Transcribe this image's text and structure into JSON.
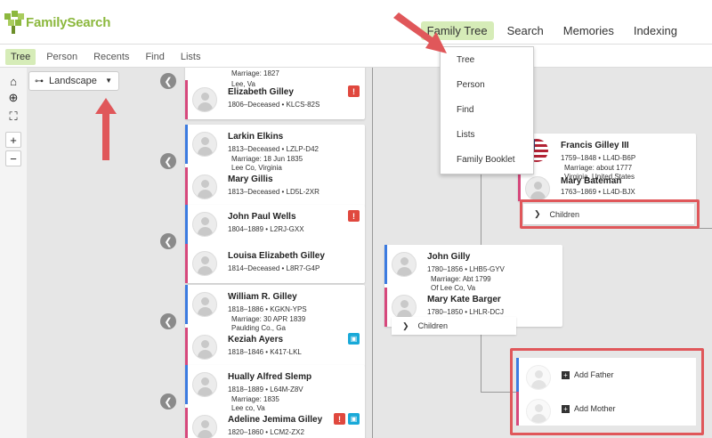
{
  "brand": {
    "name": "FamilySearch"
  },
  "main_nav": [
    {
      "label": "Family Tree",
      "active": true
    },
    {
      "label": "Search"
    },
    {
      "label": "Memories"
    },
    {
      "label": "Indexing"
    }
  ],
  "sub_nav": [
    {
      "label": "Tree",
      "active": true
    },
    {
      "label": "Person"
    },
    {
      "label": "Recents"
    },
    {
      "label": "Find"
    },
    {
      "label": "Lists"
    }
  ],
  "view_selector": {
    "value": "Landscape"
  },
  "dropdown_items": [
    "Tree",
    "Person",
    "Find",
    "Lists",
    "Family Booklet"
  ],
  "couples": [
    {
      "marriage": [
        "Marriage: 1827",
        "Lee, Va"
      ],
      "wife": {
        "name": "Elizabeth Gilley",
        "dates": "1806–Deceased • KLCS-82S",
        "alert": "!"
      }
    },
    {
      "husband": {
        "name": "Larkin Elkins",
        "dates": "1813–Deceased • LZLP-D42"
      },
      "marriage": [
        "Marriage: 18 Jun 1835",
        "Lee Co, Virginia"
      ],
      "wife": {
        "name": "Mary Gillis",
        "dates": "1813–Deceased • LD5L-2XR"
      }
    },
    {
      "husband": {
        "name": "John Paul Wells",
        "dates": "1804–1889 • L2RJ-GXX",
        "alert": "!"
      },
      "wife": {
        "name": "Louisa Elizabeth Gilley",
        "dates": "1814–Deceased • L8R7-G4P"
      }
    },
    {
      "husband": {
        "name": "William R. Gilley",
        "dates": "1818–1886 • KGKN-YPS"
      },
      "marriage": [
        "Marriage: 30 APR 1839",
        "Paulding Co., Ga"
      ],
      "wife": {
        "name": "Keziah Ayers",
        "dates": "1818–1846 • K417-LKL"
      }
    },
    {
      "husband": {
        "name": "Hually Alfred Slemp",
        "dates": "1818–1889 • L64M-Z8V"
      },
      "marriage": [
        "Marriage: 1835",
        "Lee co, Va"
      ],
      "wife": {
        "name": "Adeline Jemima Gilley",
        "dates": "1820–1860 • LCM2-ZX2",
        "alert": "!"
      }
    }
  ],
  "focus_couple": {
    "husband": {
      "name": "John Gilly",
      "dates": "1780–1856 • LHB5-GYV"
    },
    "marriage": [
      "Marriage: Abt 1799",
      "Of Lee Co, Va"
    ],
    "wife": {
      "name": "Mary Kate Barger",
      "dates": "1780–1850 • LHLR-DCJ"
    },
    "children_label": "Children"
  },
  "parents_couple": {
    "husband": {
      "name": "Francis Gilley III",
      "dates": "1759–1848 • LL4D-B6P"
    },
    "marriage": [
      "Marriage: about 1777",
      "Virginia, United States"
    ],
    "wife": {
      "name": "Mary Bateman",
      "dates": "1763–1869 • LL4D-BJX"
    },
    "children_label": "Children"
  },
  "add_parents": {
    "father": "Add Father",
    "mother": "Add Mother"
  },
  "colors": {
    "accent": "#8cb83e",
    "male": "#3c7be0",
    "female": "#d6487c",
    "highlight": "#e0575a"
  }
}
